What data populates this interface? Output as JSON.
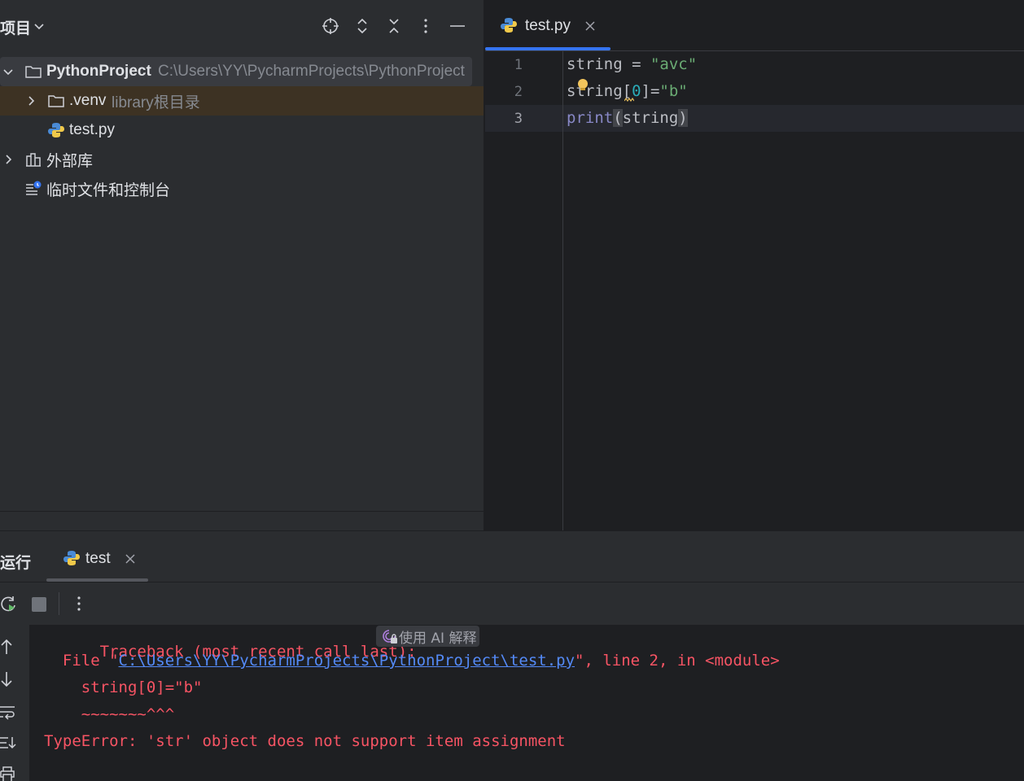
{
  "project_panel": {
    "title": "项目",
    "tree": {
      "root_name": "PythonProject",
      "root_path": "C:\\Users\\YY\\PycharmProjects\\PythonProject",
      "venv_name": ".venv",
      "venv_hint": "library根目录",
      "test_file": "test.py",
      "external_libs": "外部库",
      "scratches": "临时文件和控制台"
    }
  },
  "editor": {
    "tab_label": "test.py",
    "line_numbers": [
      "1",
      "2",
      "3"
    ],
    "code": {
      "l1_a": "string = ",
      "l1_str": "\"avc\"",
      "l2_a": "string[",
      "l2_num": "0",
      "l2_b": "]=",
      "l2_str": "\"b\"",
      "l3_fn": "print",
      "l3_open": "(",
      "l3_arg": "string",
      "l3_close": ")"
    }
  },
  "run_panel": {
    "title": "运行",
    "tab_label": "test",
    "console": {
      "traceback": "Traceback (most recent call last):",
      "ai_explain": "使用 AI 解释",
      "file_prefix": "  File \"",
      "file_path": "C:\\Users\\YY\\PycharmProjects\\PythonProject\\test.py",
      "file_suffix": "\", line 2, in <module>",
      "code_line": "    string[0]=\"b\"",
      "caret_line": "    ~~~~~~~^^^",
      "error": "TypeError: 'str' object does not support item assignment"
    }
  },
  "colors": {
    "accent": "#3574f0",
    "error_text": "#f75464",
    "link": "#548af7",
    "string": "#6aab73",
    "number": "#2aacb8",
    "builtin": "#8888c6"
  }
}
